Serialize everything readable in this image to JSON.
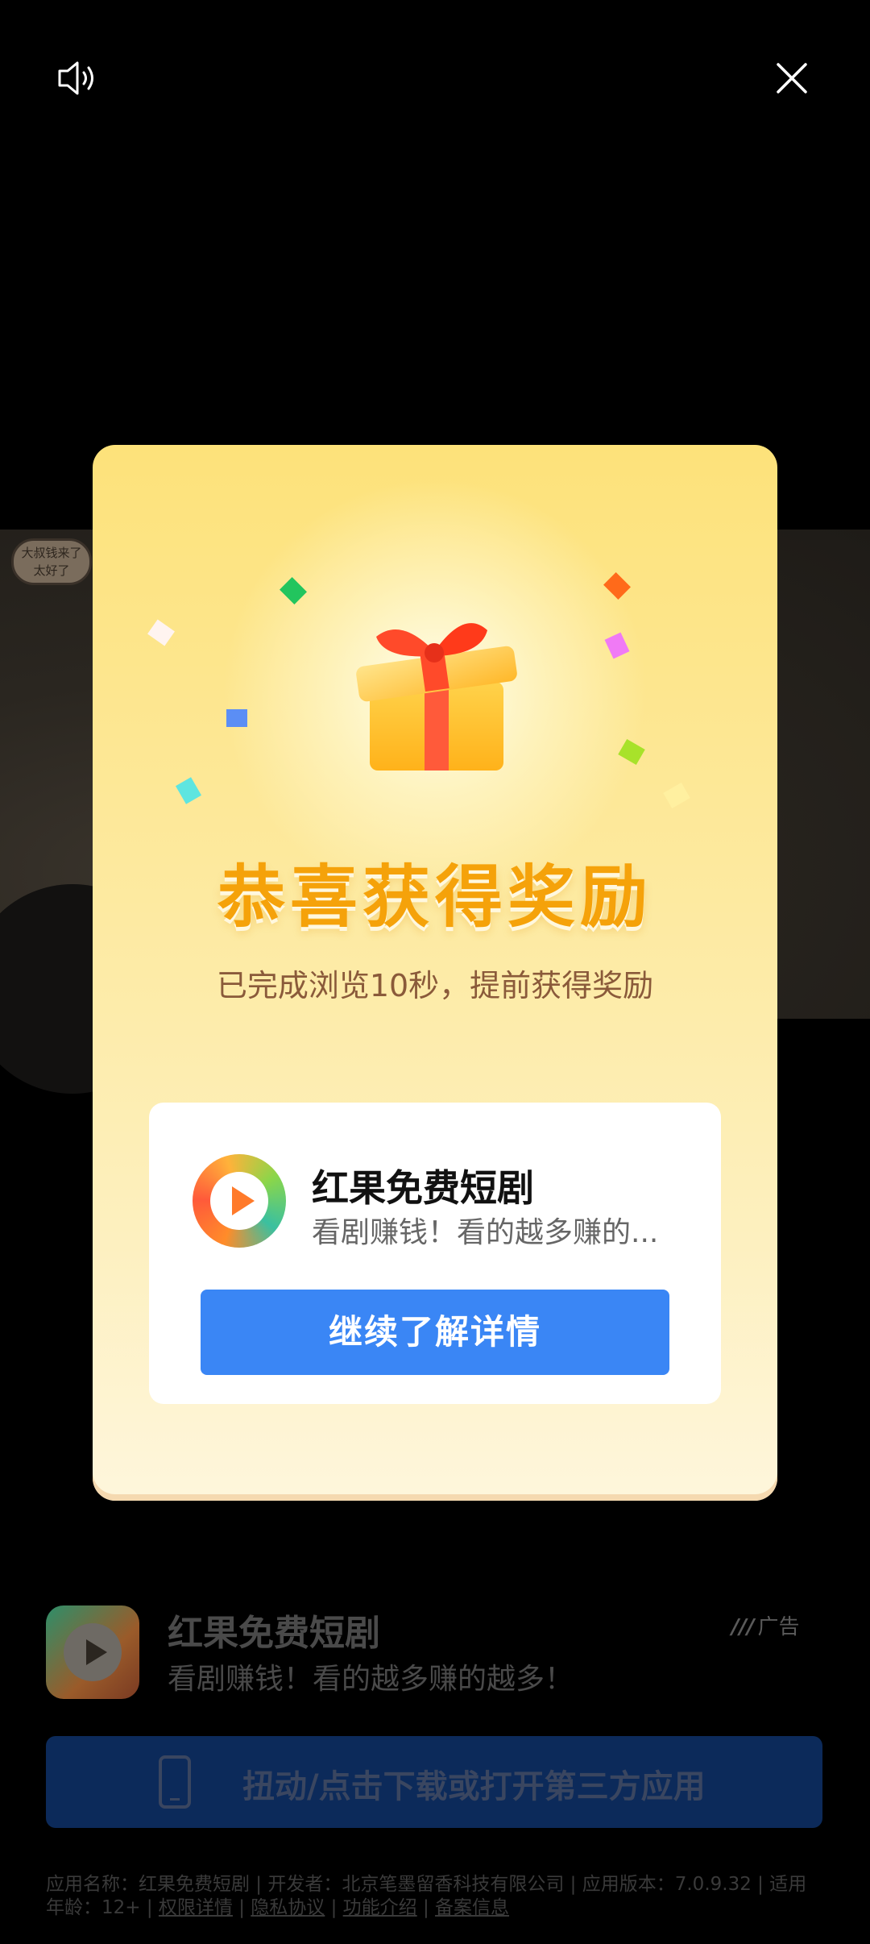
{
  "controls": {
    "sound_icon": "speaker-icon",
    "close_icon": "close-icon"
  },
  "video": {
    "sticker_text": "大叔钱来了 太好了"
  },
  "modal": {
    "title": "恭喜获得奖励",
    "subtitle": "已完成浏览10秒，提前获得奖励",
    "card": {
      "app_name": "红果免费短剧",
      "app_desc": "看剧赚钱！看的越多赚的...",
      "button_label": "继续了解详情"
    },
    "colors": {
      "title": "#f5a20a",
      "button": "#3a86f5",
      "background_top": "#fde27a"
    }
  },
  "ad": {
    "app_name": "红果免费短剧",
    "app_desc": "看剧赚钱！看的越多赚的越多！",
    "badge": "广告",
    "download_label": "扭动/点击下载或打开第三方应用",
    "info_line1": "应用名称：红果免费短剧 | 开发者：北京笔墨留香科技有限公司 | 应用版本：7.0.9.32 | 适用",
    "info_prefix": "年龄：12+ | ",
    "links": [
      "权限详情",
      "隐私协议",
      "功能介绍",
      "备案信息"
    ]
  }
}
